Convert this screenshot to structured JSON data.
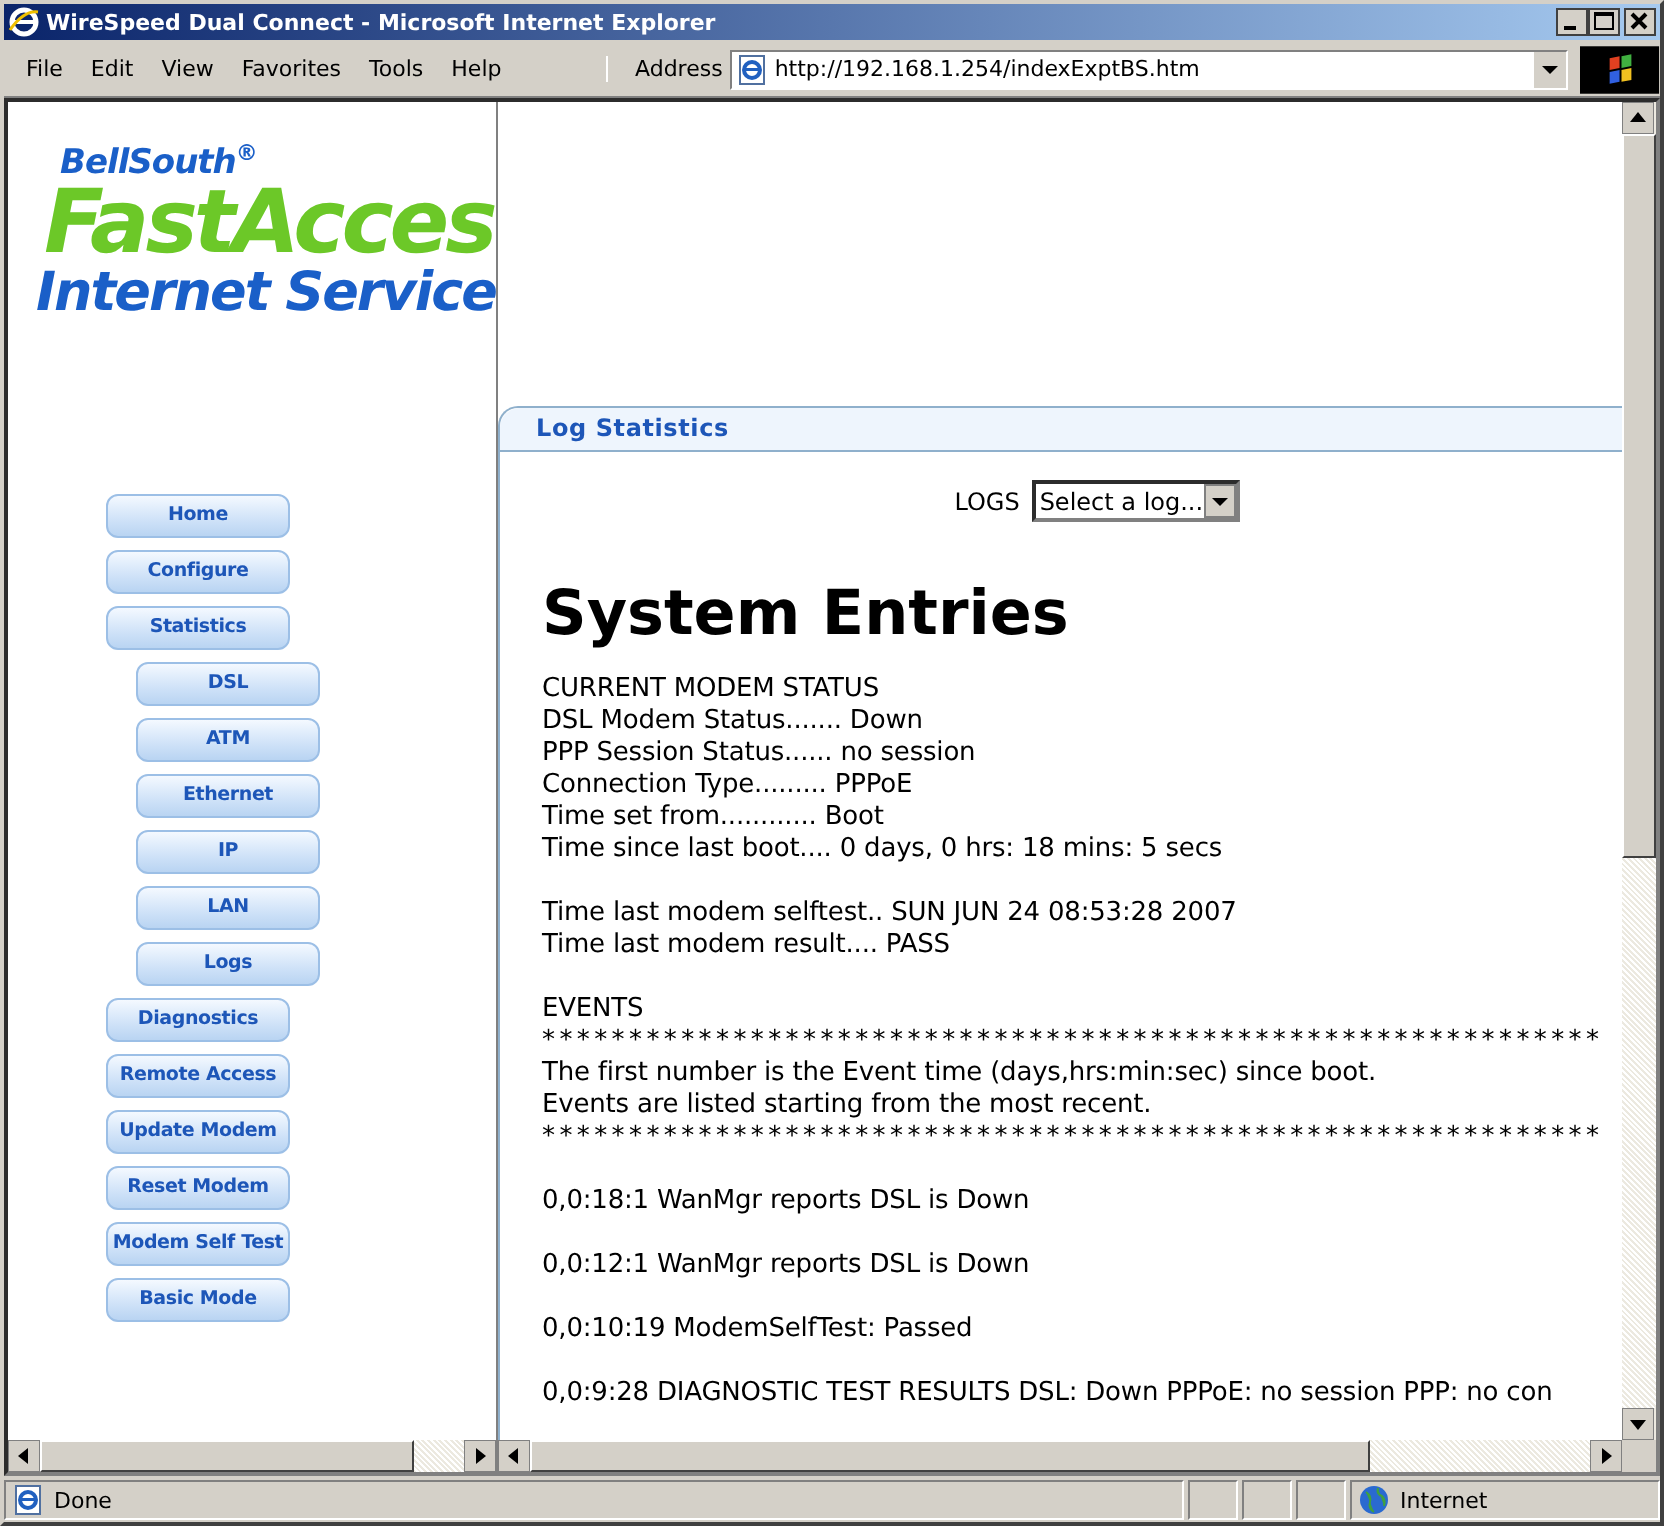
{
  "window": {
    "title": "WireSpeed Dual Connect - Microsoft Internet Explorer"
  },
  "menu": [
    "File",
    "Edit",
    "View",
    "Favorites",
    "Tools",
    "Help"
  ],
  "address": {
    "label": "Address",
    "value": "http://192.168.1.254/indexExptBS.htm"
  },
  "logo": {
    "brand": "BellSouth$^{®}$",
    "product": "FastAcces",
    "service": "Internet Service"
  },
  "nav": [
    {
      "label": "Home"
    },
    {
      "label": "Configure"
    },
    {
      "label": "Statistics",
      "children": [
        {
          "label": "DSL"
        },
        {
          "label": "ATM"
        },
        {
          "label": "Ethernet"
        },
        {
          "label": "IP"
        },
        {
          "label": "LAN"
        },
        {
          "label": "Logs"
        }
      ]
    },
    {
      "label": "Diagnostics"
    },
    {
      "label": "Remote Access"
    },
    {
      "label": "Update Modem"
    },
    {
      "label": "Reset Modem"
    },
    {
      "label": "Modem Self Test"
    },
    {
      "label": "Basic Mode"
    }
  ],
  "panel": {
    "title": "Log Statistics",
    "logs_label": "LOGS",
    "select": {
      "value": "Select a log..."
    },
    "heading": "System Entries",
    "blocks": [
      {
        "kind": "text",
        "lines": [
          "CURRENT MODEM STATUS",
          "DSL Modem Status....... Down",
          "PPP Session Status...... no session",
          "Connection Type......... PPPoE",
          "Time set from............ Boot",
          "Time since last boot.... 0 days, 0 hrs: 18 mins: 5 secs"
        ]
      },
      {
        "kind": "text",
        "lines": [
          "Time last modem selftest.. SUN JUN 24 08:53:28 2007",
          "Time last modem result.... PASS"
        ]
      },
      {
        "kind": "text",
        "lines": [
          "EVENTS"
        ]
      },
      {
        "kind": "rule",
        "lines": [
          "*************************************************************"
        ]
      },
      {
        "kind": "note",
        "lines": [
          "The first number is the Event time (days,hrs:min:sec) since boot.",
          "Events are listed starting from the most recent."
        ]
      },
      {
        "kind": "rule",
        "lines": [
          "*************************************************************"
        ]
      },
      {
        "kind": "event",
        "lines": [
          "0,0:18:1 WanMgr reports DSL is Down"
        ]
      },
      {
        "kind": "event",
        "lines": [
          "0,0:12:1 WanMgr reports DSL is Down"
        ]
      },
      {
        "kind": "event",
        "lines": [
          "0,0:10:19 ModemSelfTest: Passed"
        ]
      },
      {
        "kind": "event",
        "lines": [
          "0,0:9:28 DIAGNOSTIC TEST RESULTS DSL: Down PPPoE: no session PPP: no con"
        ]
      }
    ]
  },
  "status_bar": {
    "text": "Done",
    "zone": "Internet"
  }
}
